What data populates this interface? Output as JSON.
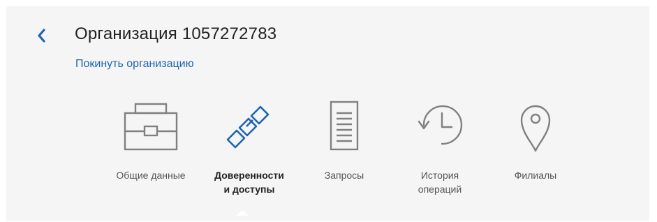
{
  "header": {
    "back_icon": "chevron-left-icon",
    "title": "Организация 1057272783",
    "leave_link": "Покинуть организацию"
  },
  "tabs": [
    {
      "label": "Общие данные",
      "icon": "briefcase-icon",
      "active": false
    },
    {
      "label": "Доверенности\nи доступы",
      "icon": "chain-link-icon",
      "active": true
    },
    {
      "label": "Запросы",
      "icon": "document-lines-icon",
      "active": false
    },
    {
      "label": "История\nопераций",
      "icon": "history-clock-icon",
      "active": false
    },
    {
      "label": "Филиалы",
      "icon": "map-pin-icon",
      "active": false
    }
  ],
  "colors": {
    "accent": "#1f64b2",
    "icon_gray": "#808080",
    "panel_bg": "#f5f5f5"
  }
}
